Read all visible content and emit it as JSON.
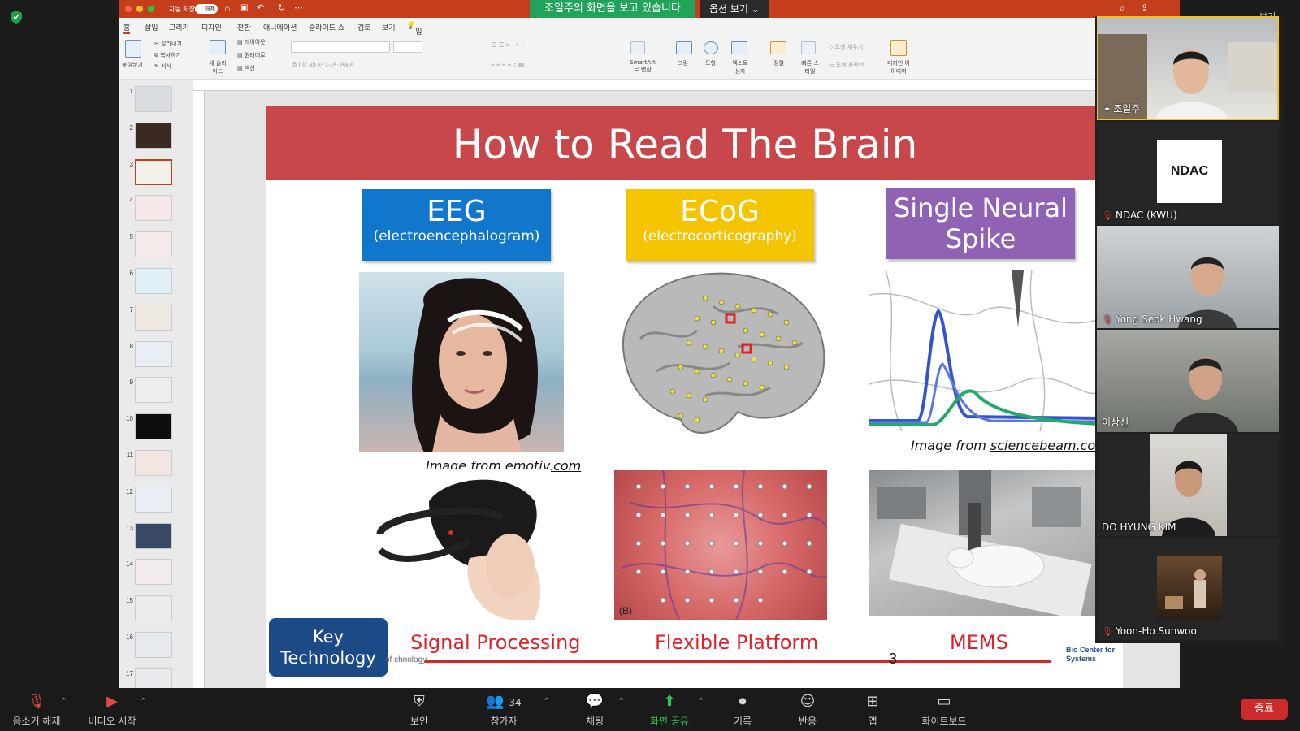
{
  "app": {
    "share_banner": "조일주의 화면을 보고 있습니다",
    "view_options": "옵션 보기",
    "autosave_label": "자동 저장",
    "autosave_state": "해제",
    "top_right": "보기"
  },
  "ppt": {
    "menu": [
      "홈",
      "삽입",
      "그리기",
      "디자인",
      "전환",
      "애니메이션",
      "슬라이드 쇼",
      "검토",
      "보기",
      "입력하세요"
    ],
    "ribbon_labels": {
      "paste": "붙여넣기",
      "cut": "잘라내기",
      "copy": "복사하기",
      "format": "서식",
      "new_slide": "새 슬라이드",
      "layout": "레이아웃",
      "reset": "원래대로",
      "section": "섹션",
      "smartart": "SmartArt로 변환",
      "picture": "그림",
      "shapes": "도형",
      "textbox": "텍스트 상자",
      "arrange": "정렬",
      "quick_styles": "빠른 스타일",
      "shape_fill": "도형 채우기",
      "shape_outline": "도형 윤곽선",
      "design_ideas": "디자인 아이디어"
    },
    "thumbnails": [
      "1",
      "2",
      "3",
      "4",
      "5",
      "6",
      "7",
      "8",
      "9",
      "10",
      "11",
      "12",
      "13",
      "14",
      "15",
      "16",
      "17"
    ],
    "active_slide": 3
  },
  "slide": {
    "title": "How to Read The Brain",
    "boxes": [
      {
        "title": "EEG",
        "subtitle": "(electroencephalogram)",
        "color": "#1177cc"
      },
      {
        "title": "ECoG",
        "subtitle": "(electrocorticography)",
        "color": "#f5c400"
      },
      {
        "title": "Single Neural Spike",
        "subtitle": "",
        "color": "#8f62b3"
      }
    ],
    "caption_left_prefix": "Image from ",
    "caption_left_link": "emotiv.com",
    "caption_right_prefix": "Image from ",
    "caption_right_link": "sciencebeam.com",
    "ecog_label": "(B)",
    "key_technology": "Key Technology",
    "tech_items": [
      "Signal Processing",
      "Flexible Platform",
      "MEMS"
    ],
    "page_number": "3",
    "footer_left": "of chnology",
    "logo_text": "Bio Center for Systems"
  },
  "participants": [
    {
      "name": "조일주",
      "muted": false
    },
    {
      "name": "NDAC (KWU)",
      "muted": true
    },
    {
      "name": "Yong Seok Hwang",
      "muted": true
    },
    {
      "name": "이상신",
      "muted": false
    },
    {
      "name": "DO HYUNG KIM",
      "muted": false
    },
    {
      "name": "Yoon-Ho Sunwoo",
      "muted": true
    }
  ],
  "ndac_logo": "NDAC",
  "toolbar": {
    "unmute": "음소거 해제",
    "video": "비디오 시작",
    "security": "보안",
    "participants": "참가자",
    "participant_count": "34",
    "chat": "채팅",
    "share": "화면 공유",
    "record": "기록",
    "reactions": "반응",
    "apps": "앱",
    "whiteboard": "화이트보드",
    "end": "종료"
  }
}
